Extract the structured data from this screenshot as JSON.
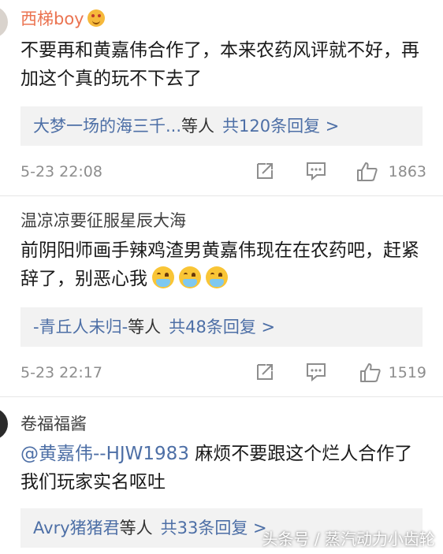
{
  "comments": [
    {
      "username": "西梯boy",
      "text": "不要再和黄嘉伟合作了，本来农药风评就不好，再加这个真的玩不下去了",
      "reply_names": "大梦一场的海三千...",
      "reply_deng": "等人",
      "reply_count": "共120条回复 >",
      "time": "5-23 22:08",
      "likes": "1863"
    },
    {
      "username": "温凉凉要征服星辰大海",
      "text": "前阴阳师画手辣鸡渣男黄嘉伟现在在农药吧，赶紧辞了，别恶心我",
      "reply_names": "-青丘人未归-",
      "reply_deng": "等人",
      "reply_count": "共48条回复 >",
      "time": "5-23 22:17",
      "likes": "1519"
    },
    {
      "username": "卷福福酱",
      "mention": "@黄嘉伟--HJW1983",
      "text": " 麻烦不要跟这个烂人合作了 我们玩家实名呕吐",
      "reply_names": "Avry猪猪君",
      "reply_deng": "等人",
      "reply_count": "共33条回复 >"
    }
  ],
  "watermark": "头条号 / 蒸汽动力小齿轮",
  "colors": {
    "name_orange": "#eb7350",
    "link_blue": "#4d6fa6",
    "reply_bg": "#f2f2f2"
  }
}
